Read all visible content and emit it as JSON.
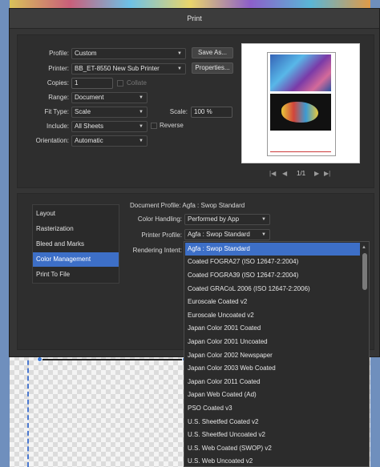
{
  "dialog": {
    "title": "Print"
  },
  "top": {
    "profile": {
      "label": "Profile:",
      "value": "Custom",
      "button": "Save As..."
    },
    "printer": {
      "label": "Printer:",
      "value": "BB_ET-8550 New Sub Printer",
      "button": "Properties..."
    },
    "copies": {
      "label": "Copies:",
      "value": "1",
      "collate": "Collate"
    },
    "range": {
      "label": "Range:",
      "value": "Document"
    },
    "fit_type": {
      "label": "Fit Type:",
      "value": "Scale",
      "scale_label": "Scale:",
      "scale_value": "100 %"
    },
    "include": {
      "label": "Include:",
      "value": "All Sheets",
      "reverse": "Reverse"
    },
    "orientation": {
      "label": "Orientation:",
      "value": "Automatic"
    },
    "pager": {
      "first": "|◀",
      "prev": "◀",
      "page": "1/1",
      "next": "▶",
      "last": "▶|"
    }
  },
  "sidebar": {
    "items": [
      {
        "label": "Layout",
        "active": false
      },
      {
        "label": "Rasterization",
        "active": false
      },
      {
        "label": "Bleed and Marks",
        "active": false
      },
      {
        "label": "Color Management",
        "active": true
      },
      {
        "label": "Print To File",
        "active": false
      }
    ]
  },
  "color": {
    "document_profile": "Document Profile: Agfa : Swop Standard",
    "handling": {
      "label": "Color Handling:",
      "value": "Performed by App"
    },
    "printer_profile": {
      "label": "Printer Profile:",
      "value": "Agfa : Swop Standard"
    },
    "rendering_intent": {
      "label": "Rendering Intent:"
    }
  },
  "profile_list": {
    "items": [
      "Agfa : Swop Standard",
      "Coated FOGRA27 (ISO 12647-2:2004)",
      "Coated FOGRA39 (ISO 12647-2:2004)",
      "Coated GRACoL 2006 (ISO 12647-2:2006)",
      "Euroscale Coated v2",
      "Euroscale Uncoated v2",
      "Japan Color 2001 Coated",
      "Japan Color 2001 Uncoated",
      "Japan Color 2002 Newspaper",
      "Japan Color 2003 Web Coated",
      "Japan Color 2011 Coated",
      "Japan Web Coated (Ad)",
      "PSO Coated v3",
      "U.S. Sheetfed Coated v2",
      "U.S. Sheetfed Uncoated v2",
      "U.S. Web Coated (SWOP) v2",
      "U.S. Web Uncoated v2"
    ],
    "selected_index": 0
  },
  "colors": {
    "accent": "#3d6fc7",
    "dialog_bg": "#353535",
    "panel_bg": "#2e2e2e"
  }
}
